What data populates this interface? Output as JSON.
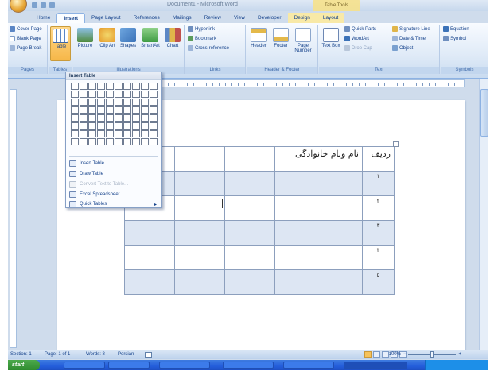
{
  "titlebar": {
    "title": "Document1 - Microsoft Word",
    "context_tab": "Table Tools"
  },
  "tabs": [
    "Home",
    "Insert",
    "Page Layout",
    "References",
    "Mailings",
    "Review",
    "View",
    "Developer",
    "Design",
    "Layout"
  ],
  "active_tab": "Insert",
  "ribbon": {
    "pages": {
      "items": [
        "Cover Page",
        "Blank Page",
        "Page Break"
      ],
      "label": "Pages"
    },
    "tables": {
      "button": "Table",
      "label": "Tables"
    },
    "illustrations": {
      "items": [
        "Picture",
        "Clip Art",
        "Shapes",
        "SmartArt",
        "Chart"
      ],
      "label": "Illustrations"
    },
    "links": {
      "items": [
        "Hyperlink",
        "Bookmark",
        "Cross-reference"
      ],
      "label": "Links"
    },
    "header_footer": {
      "items": [
        "Header",
        "Footer",
        "Page Number"
      ],
      "label": "Header & Footer"
    },
    "text": {
      "big": "Text Box",
      "items": [
        "Quick Parts",
        "WordArt",
        "Drop Cap",
        "Signature Line",
        "Date & Time",
        "Object"
      ],
      "label": "Text"
    },
    "symbols": {
      "items": [
        "Equation",
        "Symbol"
      ],
      "label": "Symbols"
    }
  },
  "dropdown": {
    "title": "Insert Table",
    "grid": {
      "cols": 10,
      "rows": 8
    },
    "items": [
      {
        "label": "Insert Table...",
        "enabled": true,
        "submenu": false
      },
      {
        "label": "Draw Table",
        "enabled": true,
        "submenu": false
      },
      {
        "label": "Convert Text to Table...",
        "enabled": false,
        "submenu": false
      },
      {
        "label": "Excel Spreadsheet",
        "enabled": true,
        "submenu": false
      },
      {
        "label": "Quick Tables",
        "enabled": true,
        "submenu": true
      }
    ]
  },
  "doc_table": {
    "headers": [
      "ردیف",
      "نام ونام خانوادگی",
      "",
      "",
      "",
      ""
    ],
    "rows": [
      "۱",
      "۲",
      "۳",
      "۴",
      "۵"
    ]
  },
  "statusbar": {
    "section": "Section: 1",
    "page": "Page: 1 of 1",
    "words": "Words: 8",
    "language": "Persian",
    "zoom": "100%"
  },
  "taskbar": {
    "start": "start",
    "tasks": [
      "",
      "",
      "",
      "",
      "",
      ""
    ]
  }
}
